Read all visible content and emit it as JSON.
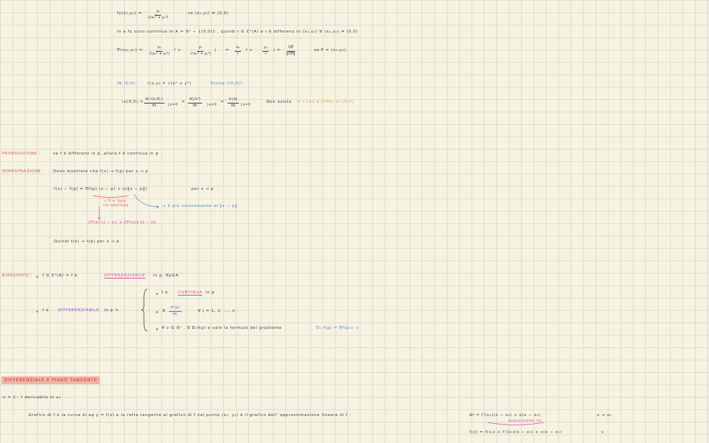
{
  "block1": {
    "fy_lhs": "fy(x₀,y₀) =",
    "fy_num": "y₀",
    "fy_den": "√(x₀² + y₀²)",
    "fy_cond": "se (x₀,y₀) ≠ (0,0)",
    "cont_line": "fx e fy sono continue in A = ℝ² − {(0,0)} ,  quindi   r ∈ ℭ¹(A)    e  r è differenz in (x₀,y₀)   ∀ (x₀,y₀) ≠ (0,0)",
    "grad_lhs": "∇r(x₀,y₀) =",
    "g1_num": "x₀",
    "g1_den": "√(x₀² + y₀²)",
    "g1_vec": "î   +",
    "g2_num": "y₀",
    "g2_den": "√(x₀² + y₀²)",
    "g2_vec": "ĵ",
    "g_eq": "=",
    "g3_num": "x₀",
    "g3_den": "r",
    "g3_vec": "î   +",
    "g4_num": "y₀",
    "g4_den": "r",
    "g4_vec": "ĵ    =",
    "g5_num": "OP⃗",
    "g5_den": "‖OP‖",
    "g_cond": "se P = (x₀,y₀)"
  },
  "block2": {
    "label": "IN (0,0):",
    "r_def": "r(x,y) = √(x² + y²)",
    "exists": "Esiste   r(0,0)?",
    "rx_lhs": "rx(0,0) =",
    "f1_num": "d( r(x,0) )",
    "f1_den": "dx",
    "sub1": "|x=0",
    "eq1": "=",
    "f2_num": "d(√x²)",
    "f2_den": "dx",
    "sub2": "|x=0",
    "eq2": "=",
    "f3_num": "d |x|",
    "f3_den": "dx",
    "sub3": "|x=0",
    "not_exists": "Non esiste",
    "conclusion": "⇒ r non è differ in (0,0)"
  },
  "proposizione": {
    "label": "PROPOSIZIONE :",
    "text": "se  f  è  differenz  in  p,  allora  f  è  continua  in  p"
  },
  "dimostrazione": {
    "label": "DIMOSTRAZIONE :",
    "line1": "Devo mostrare che  f(x) → f(p)          per  x → p",
    "line2": "f(x) − f(p) = ∇f(p)·(x − p)  + o(‖x − p‖)",
    "line2_cond": "per  x → p",
    "note_red": "→ 0  = funz",
    "note_red2": "lin continua",
    "note_blue": "→ 0  più velocemente di  ‖x − p‖",
    "note_pink": "|∇f(p)·(x − p)| ≤ ‖∇f(p)‖ ‖x − p‖",
    "line3": "Quindi  f(x) → f(p)      per  x → p"
  },
  "riassunto": {
    "label": "RIASSUNTO :",
    "line1a": "f ∈ ℭ¹(A)     ⇒  f  è",
    "line1_diff": "DIFFERENZIABILE",
    "line1b": "in  p,  ∀p∈A",
    "main_a": "f  è",
    "main_diff": "DIFFERENZIABILE",
    "main_b": "in  p     ⇒",
    "b1a": "f  è",
    "b1_cont": "CONTINUA",
    "b1b": "in  p",
    "b2a": "∃",
    "b2_num": "∂f (p)",
    "b2_den": "∂xⱼ",
    "b2b": "∀ j = 1, 2, ..., n",
    "b3a": "∀ v ∈ ℝⁿ ,   ∃  Dᵥf(p)   e  vale  la  formula  del  gradiente",
    "b3_formula": "Dᵥ f(p) = ∇f(p₀)· v"
  },
  "piano": {
    "title": "DIFFERENZIALE  E  PIANO  TANGENTE",
    "n1": "n = 1 :    f  derivabile   in   x₀",
    "grafico": "Grafico  di  f  è  la  curva  di  eq  y = f(x)   e  la  retta  tangente  al  grafico  di  f  nel  punto  (x₀, y₀)  è  il  grafico  dell' approssimazione  lineare  di  f :",
    "delta_f": "Δf =  f'(x₀)(x − x₀)  + o(x − x₀)",
    "arrow": "x → x₀",
    "approx_label": "Approssimaz lin",
    "fx_line": "f(x) =  f(x₀)  +  f'(x₀)(x − x₀)  + o(x − x₀)",
    "tail": "ν"
  },
  "colors": {
    "ink": "#3c3a36",
    "red": "#d9534f",
    "blue": "#3f7ccd",
    "pink": "#d84aa0",
    "orange": "#e39a3b",
    "green": "#6cc24a",
    "banner": "#f2b4a8"
  }
}
